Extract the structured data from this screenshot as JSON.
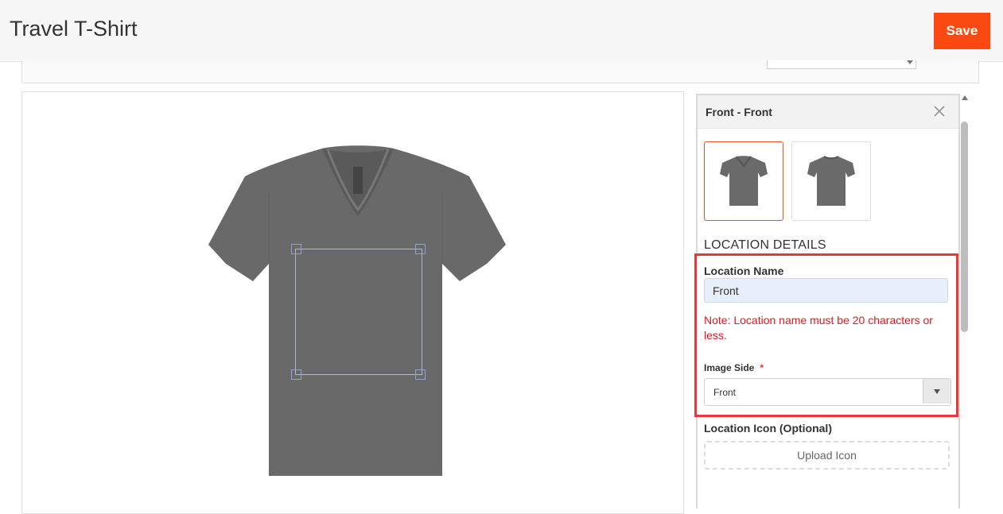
{
  "header": {
    "title": "Travel T-Shirt",
    "save_label": "Save"
  },
  "toolstrip": {
    "select_value": ""
  },
  "canvas": {
    "product_image": "gray-v-neck-tshirt-front",
    "print_area": "front-print-area"
  },
  "panel": {
    "title": "Front - Front",
    "thumbnails": [
      {
        "name": "front-thumbnail",
        "selected": true
      },
      {
        "name": "back-thumbnail",
        "selected": false
      }
    ],
    "section_heading": "LOCATION DETAILS",
    "location_name": {
      "label": "Location Name",
      "value": "Front"
    },
    "note": "Note: Location name must be 20 characters or less.",
    "image_side": {
      "label": "Image Side",
      "required_mark": "*",
      "value": "Front"
    },
    "location_icon": {
      "label": "Location Icon (Optional)",
      "upload_label": "Upload  Icon"
    }
  },
  "colors": {
    "accent": "#fa4a12",
    "highlight": "#e8393a",
    "note": "#e8151b",
    "shirt": "#6b6b6b"
  }
}
